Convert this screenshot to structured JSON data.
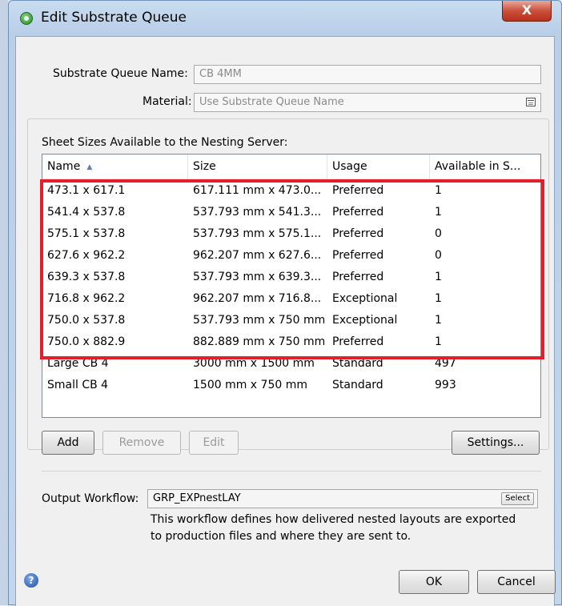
{
  "window": {
    "title": "Edit Substrate Queue",
    "close_glyph": "X"
  },
  "form": {
    "queue_name_label": "Substrate Queue Name:",
    "queue_name_value": "CB 4MM",
    "material_label": "Material:",
    "material_value": "Use Substrate Queue Name"
  },
  "sheets": {
    "group_label": "Sheet Sizes Available to the Nesting Server:",
    "columns": [
      "Name",
      "Size",
      "Usage",
      "Available in S..."
    ],
    "rows": [
      [
        "473.1 x 617.1",
        "617.111 mm x 473.0...",
        "Preferred",
        "1"
      ],
      [
        "541.4 x 537.8",
        "537.793 mm x 541.3...",
        "Preferred",
        "1"
      ],
      [
        "575.1 x 537.8",
        "537.793 mm x 575.1...",
        "Preferred",
        "0"
      ],
      [
        "627.6 x 962.2",
        "962.207 mm x 627.6...",
        "Preferred",
        "0"
      ],
      [
        "639.3 x 537.8",
        "537.793 mm x 639.3...",
        "Preferred",
        "1"
      ],
      [
        "716.8 x 962.2",
        "962.207 mm x 716.8...",
        "Exceptional",
        "1"
      ],
      [
        "750.0 x 537.8",
        "537.793 mm x 750 mm",
        "Exceptional",
        "1"
      ],
      [
        "750.0 x 882.9",
        "882.889 mm x 750 mm",
        "Preferred",
        "1"
      ],
      [
        "Large CB 4",
        "3000 mm x 1500 mm",
        "Standard",
        "497"
      ],
      [
        "Small CB 4",
        "1500 mm x 750 mm",
        "Standard",
        "993"
      ]
    ],
    "buttons": {
      "add": "Add",
      "remove": "Remove",
      "edit": "Edit",
      "settings": "Settings..."
    }
  },
  "output": {
    "label": "Output Workflow:",
    "value": "GRP_EXPnestLAY",
    "select_label": "Select",
    "description_line1": "This workflow defines how delivered nested layouts are exported",
    "description_line2": "to production files and where they are sent to."
  },
  "footer": {
    "help_glyph": "?",
    "ok": "OK",
    "cancel": "Cancel"
  },
  "colors": {
    "highlight": "#e41e2b",
    "title_bar": "#c9dcf0",
    "close_button": "#c9503a"
  }
}
